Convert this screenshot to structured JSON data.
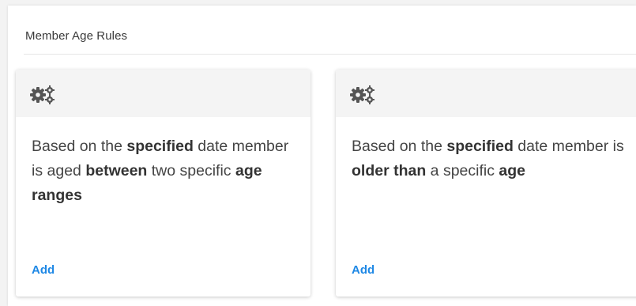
{
  "panel": {
    "title": "Member Age Rules"
  },
  "cards": [
    {
      "icon": "gears-icon",
      "text": [
        "Based on the ",
        "specified",
        " date member is aged ",
        "between",
        " two specific ",
        "age ranges"
      ],
      "add_label": "Add"
    },
    {
      "icon": "gears-icon",
      "text": [
        "Based on the ",
        "specified",
        " date member is ",
        "older than",
        " a specific ",
        "age"
      ],
      "add_label": "Add"
    }
  ],
  "colors": {
    "link": "#1e88e5",
    "card_header": "#f4f4f4"
  }
}
